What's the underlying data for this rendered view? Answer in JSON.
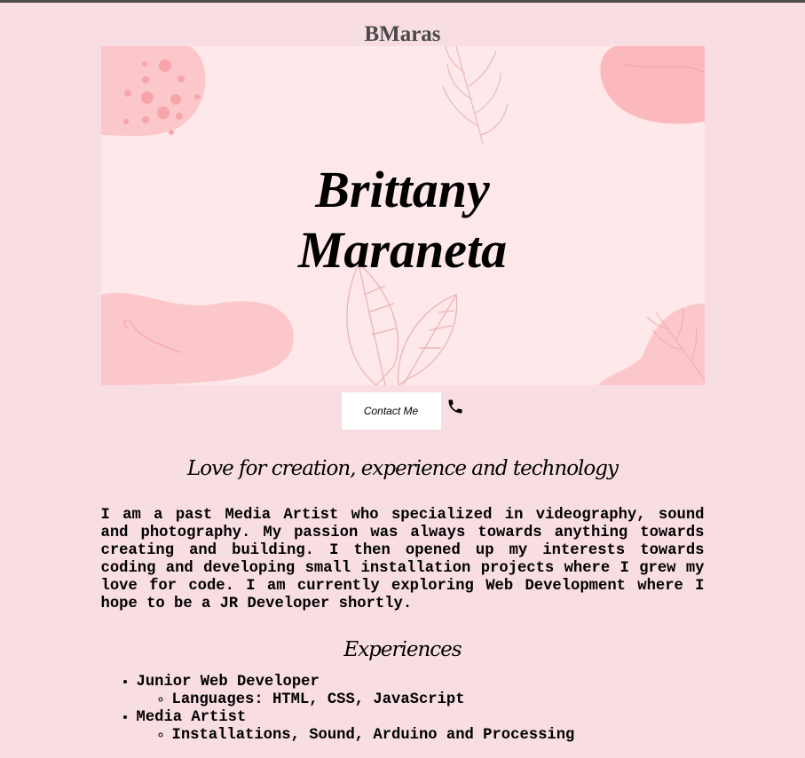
{
  "header": {
    "site_title": "BMaras"
  },
  "banner": {
    "first_name": "Brittany",
    "last_name": "Maraneta"
  },
  "contact": {
    "button_label": "Contact Me",
    "icon": "phone-icon"
  },
  "about": {
    "heading": "Love for creation, experience and technology",
    "text": "I am a past Media Artist who specialized in videography, sound and photography. My passion was always towards anything towards creating and building. I then opened up my interests towards coding and developing small installation projects where I grew my love for code. I am currently exploring Web Development where I hope to be a JR Developer shortly."
  },
  "experiences": {
    "heading": "Experiences",
    "items": [
      {
        "title": "Junior Web Developer",
        "details": [
          "Languages: HTML, CSS, JavaScript"
        ]
      },
      {
        "title": "Media Artist",
        "details": [
          "Installations, Sound, Arduino and Processing"
        ]
      }
    ]
  },
  "colors": {
    "page_background": "#f8dde2",
    "banner_background": "#fee8ea",
    "blob_pink": "#fbb9bd",
    "title_gray": "#4a4a4a"
  }
}
